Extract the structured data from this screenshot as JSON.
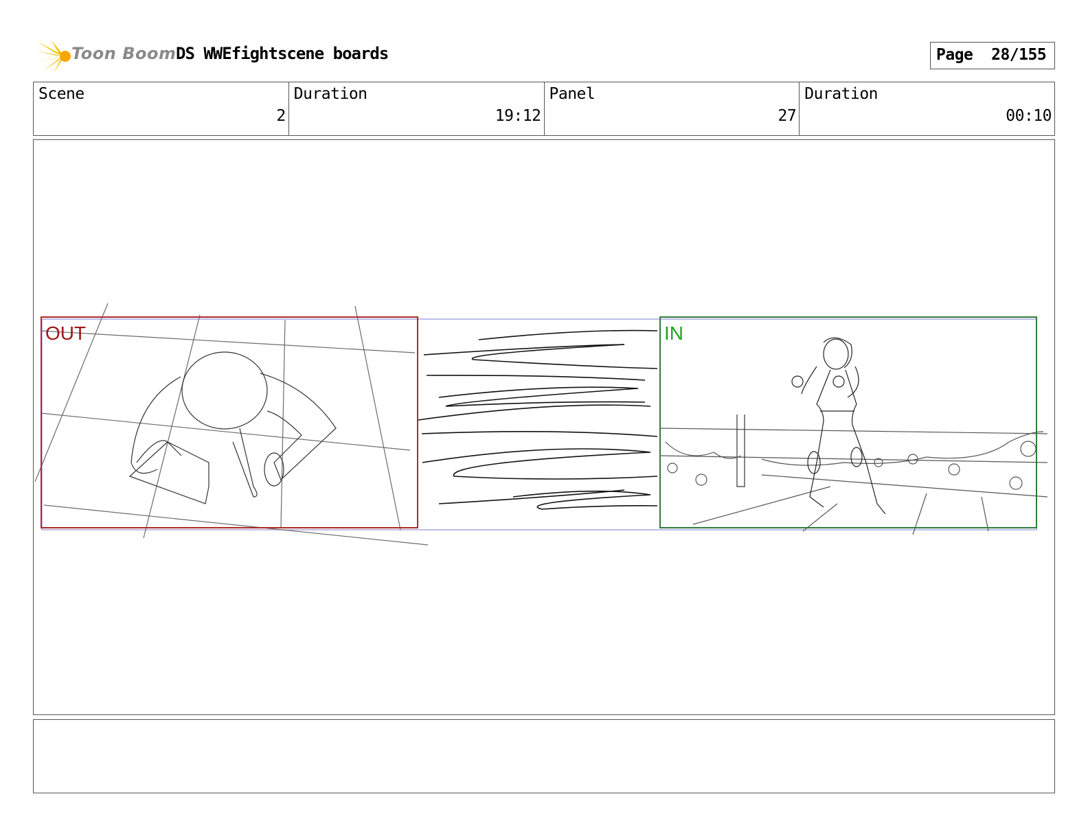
{
  "header": {
    "logo_text": "Toon Boom",
    "title": "DS WWEfightscene boards",
    "page_label": "Page",
    "page_value": "28/155"
  },
  "info": [
    {
      "label": "Scene",
      "value": "2"
    },
    {
      "label": "Duration",
      "value": "19:12"
    },
    {
      "label": "Panel",
      "value": "27"
    },
    {
      "label": "Duration",
      "value": "00:10"
    }
  ],
  "panel": {
    "out_label": "OUT",
    "in_label": "IN",
    "colors": {
      "out": "#b02828",
      "in": "#2e7d3a",
      "in_text": "#1fa31f",
      "guide": "#a9a9e0"
    }
  },
  "caption": ""
}
